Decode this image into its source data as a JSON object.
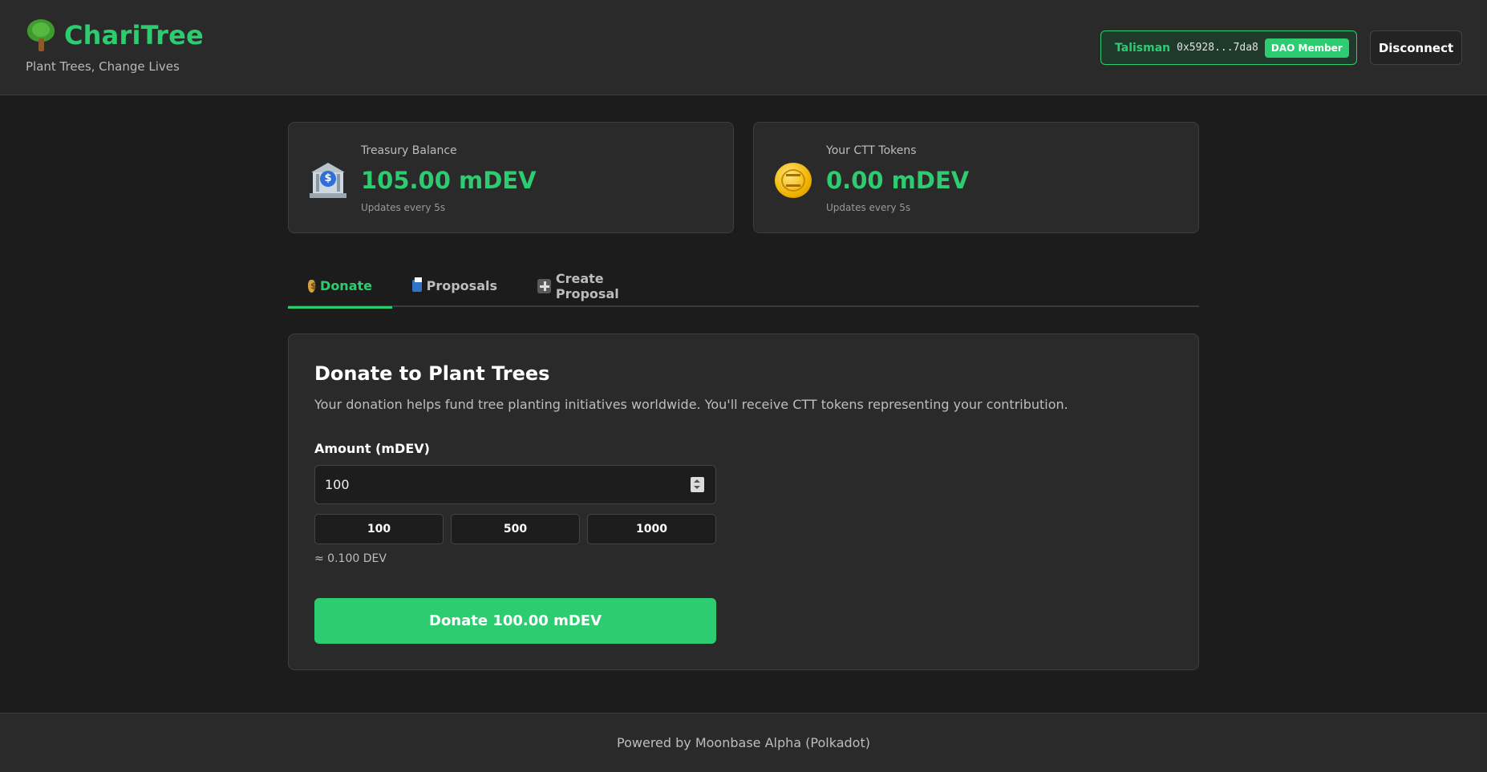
{
  "header": {
    "app_title": "ChariTree",
    "tagline": "Plant Trees, Change Lives",
    "wallet": {
      "name": "Talisman",
      "address": "0x5928...7da8",
      "badge": "DAO Member"
    },
    "disconnect_label": "Disconnect"
  },
  "stats": {
    "treasury": {
      "label": "Treasury Balance",
      "value": "105.00 mDEV",
      "note": "Updates every 5s"
    },
    "tokens": {
      "label": "Your CTT Tokens",
      "value": "0.00 mDEV",
      "note": "Updates every 5s"
    }
  },
  "tabs": [
    {
      "label": "Donate",
      "icon": "money-bag-icon",
      "active": true
    },
    {
      "label": "Proposals",
      "icon": "ballot-box-icon",
      "active": false
    },
    {
      "label": "Create Proposal",
      "icon": "plus-icon",
      "active": false
    }
  ],
  "donate": {
    "title": "Donate to Plant Trees",
    "description": "Your donation helps fund tree planting initiatives worldwide. You'll receive CTT tokens representing your contribution.",
    "amount_label": "Amount (mDEV)",
    "amount_value": "100",
    "presets": [
      "100",
      "500",
      "1000"
    ],
    "conversion": "≈ 0.100 DEV",
    "submit_label": "Donate 100.00 mDEV"
  },
  "footer": {
    "text": "Powered by Moonbase Alpha (Polkadot)"
  },
  "colors": {
    "accent": "#2ecc71",
    "background": "#1c1c1c",
    "surface": "#2a2a2a"
  }
}
